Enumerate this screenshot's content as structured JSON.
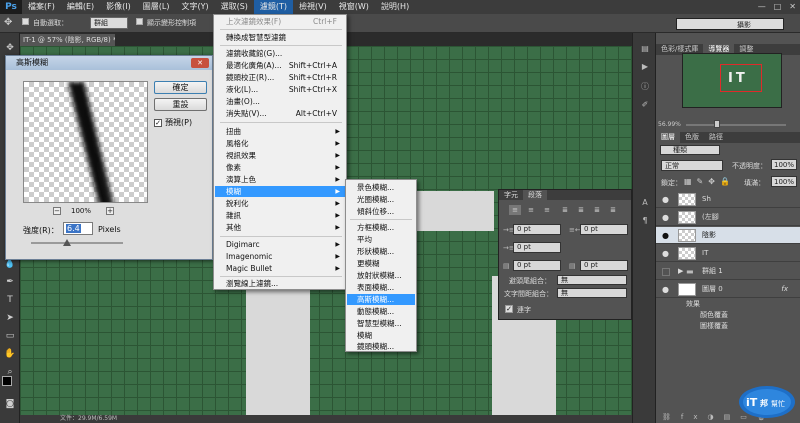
{
  "app": {
    "logo": "Ps"
  },
  "menubar": {
    "items": [
      "檔案(F)",
      "編輯(E)",
      "影像(I)",
      "圖層(L)",
      "文字(Y)",
      "選取(S)",
      "濾鏡(T)",
      "檢視(V)",
      "視窗(W)",
      "說明(H)"
    ],
    "active_index": 6,
    "win_ctrls": [
      "—",
      "□",
      "✕"
    ]
  },
  "options_bar": {
    "auto_select_label": "自動選取：",
    "auto_select_value": "群組",
    "transform_label": "顯示變形控制項"
  },
  "doc_tab": {
    "title": "IT-1 @ 57% (陰影, RGB/8) *",
    "close": "×"
  },
  "status": {
    "text": "文件：29.9M/6.59M"
  },
  "gaussian_dialog": {
    "title": "高斯模糊",
    "close": "✕",
    "ok": "確定",
    "reset": "重設",
    "preview_label": "預視(P)",
    "preview_checked": "✓",
    "zoom_out": "−",
    "zoom_in": "+",
    "zoom": "100%",
    "radius_label": "強度(R)：",
    "radius_value": "6.4",
    "units": "Pixels"
  },
  "filter_menu": {
    "items": [
      {
        "label": "上次濾鏡效果(F)",
        "shortcut": "Ctrl+F",
        "disabled": true
      },
      {
        "label": "轉換成智慧型濾鏡"
      },
      {
        "label": "濾鏡收藏館(G)..."
      },
      {
        "label": "最適化廣角(A)...",
        "shortcut": "Shift+Ctrl+A"
      },
      {
        "label": "鏡頭校正(R)...",
        "shortcut": "Shift+Ctrl+R"
      },
      {
        "label": "液化(L)...",
        "shortcut": "Shift+Ctrl+X"
      },
      {
        "label": "油畫(O)..."
      },
      {
        "label": "消失點(V)...",
        "shortcut": "Alt+Ctrl+V"
      },
      {
        "label": "扭曲",
        "arrow": "▶"
      },
      {
        "label": "風格化",
        "arrow": "▶"
      },
      {
        "label": "視訊效果",
        "arrow": "▶"
      },
      {
        "label": "像素",
        "arrow": "▶"
      },
      {
        "label": "演算上色",
        "arrow": "▶"
      },
      {
        "label": "模糊",
        "arrow": "▶",
        "highlight": true
      },
      {
        "label": "銳利化",
        "arrow": "▶"
      },
      {
        "label": "雜訊",
        "arrow": "▶"
      },
      {
        "label": "其他",
        "arrow": "▶"
      },
      {
        "label": "Digimarc",
        "arrow": "▶"
      },
      {
        "label": "Imagenomic",
        "arrow": "▶"
      },
      {
        "label": "Magic Bullet",
        "arrow": "▶"
      },
      {
        "label": "瀏覽線上濾鏡..."
      }
    ]
  },
  "blur_menu": {
    "items": [
      "景色模糊...",
      "光圈模糊...",
      "傾斜位移...",
      "方框模糊...",
      "平均",
      "形狀模糊...",
      "更模糊",
      "放射狀模糊...",
      "表面模糊...",
      "高斯模糊...",
      "動態模糊...",
      "智慧型模糊...",
      "模糊",
      "鏡頭模糊..."
    ],
    "highlight_index": 9
  },
  "char_panel": {
    "tabs": [
      "字元",
      "段落"
    ],
    "active_tab": 1,
    "fields": [
      "0 pt",
      "0 pt",
      "0 pt",
      "0 pt",
      "0 pt"
    ],
    "kinsoku_label": "避頭尾組合：",
    "kinsoku_value": "無",
    "mojikumi_label": "文字間距組合：",
    "mojikumi_value": "無",
    "hyphen_check": "✓",
    "hyphen_label": "連字"
  },
  "right_panel": {
    "workspace": "攝影",
    "nav_tabs": [
      "色彩/樣式庫",
      "導覽器",
      "調整"
    ],
    "nav_active": 1,
    "nav_zoom": "56.99%",
    "nav_logo": "IT",
    "layer_tabs": [
      "圖層",
      "色版",
      "路徑"
    ],
    "kind_label": "種類",
    "blend_mode": "正常",
    "opacity_label": "不透明度：",
    "opacity": "100%",
    "lock_label": "鎖定：",
    "fill_label": "填滿：",
    "fill": "100%",
    "layers": [
      {
        "name": "Sh",
        "eye": "●"
      },
      {
        "name": "(左腳",
        "eye": "●"
      },
      {
        "name": "陰影",
        "eye": "●",
        "selected": true
      },
      {
        "name": "IT",
        "eye": "●"
      },
      {
        "name": "群組 1",
        "eye": "",
        "folder": true
      },
      {
        "name": "圖層 0",
        "eye": "●",
        "fx": "fx"
      }
    ],
    "effects_label": "效果",
    "effect_items": [
      "顏色覆蓋",
      "圖樣覆蓋"
    ]
  },
  "colors": {
    "canvas_green": "#3b6e47",
    "menu_highlight": "#3399ff",
    "panel_bg": "#535353"
  }
}
